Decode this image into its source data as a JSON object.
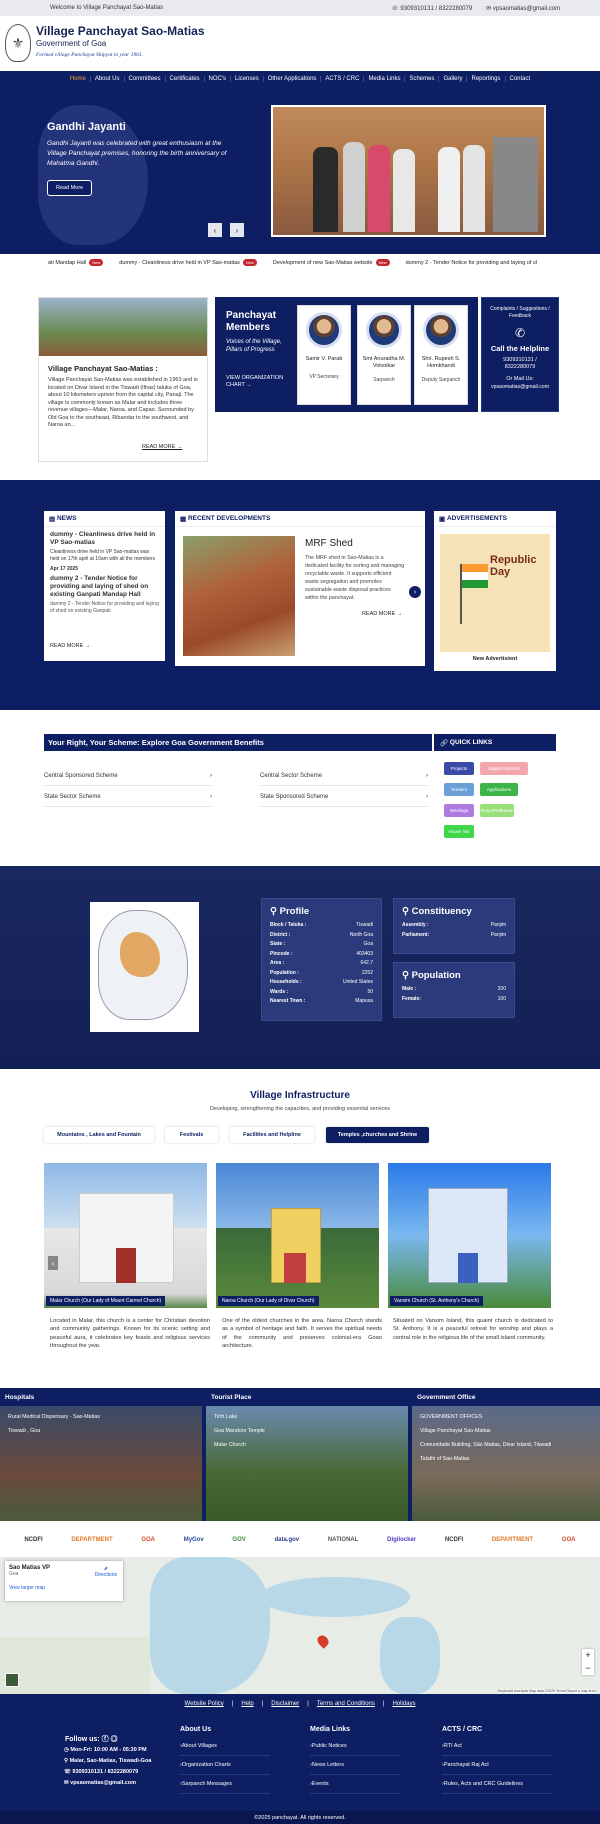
{
  "topbar": {
    "welcome": "Welcome to Village Panchayat Sao-Matias",
    "phone": "9309310131 / 8322280079",
    "email": "vpsaomatias@gmail.com"
  },
  "header": {
    "title": "Village Panchayat Sao-Matias",
    "subtitle": "Government of Goa",
    "tagline": "Formed village Panchayat Shipyat in year 1961."
  },
  "nav": [
    "Home",
    "About Us",
    "Committees",
    "Certificates",
    "NOC's",
    "Licenses",
    "Other Applications",
    "ACTS / CRC",
    "Media Links",
    "Schemes",
    "Gallery",
    "Reportings",
    "Contact"
  ],
  "hero": {
    "title": "Gandhi Jayanti",
    "text": "Gandhi Jayanti was celebrated with great enthusiasm at the Village Panchayat premises, honoring the birth anniversary of Mahatma Gandhi.",
    "button": "Read More",
    "prev": "‹",
    "next": "›"
  },
  "ticker": [
    "ati Mandap Hall",
    "dummy - Cleanliness drive held in VP Sao-matias",
    "Development of new Sao-Matias website",
    "dummy 2 - Tender Notice for providing and laying of sl"
  ],
  "ticker_tag": "New",
  "about": {
    "heading": "Village Panchayat Sao-Matias :",
    "text": "Village Panchayat Sao-Matias was established in 1963 and is located on Divar Island in the Tiswadi (Ilhas) taluka of Goa, about 10 kilometers upriver from the capital city, Panaji. The village is commonly known as Malar and includes three revenue villages—Malar, Naroa, and Capao. Surrounded by Old Goa to the southeast, Ribandar to the southwest, and Naroa an...",
    "more": "READ MORE →"
  },
  "members": {
    "heading": "Panchayat Members",
    "sub": "Voices of the Village, Pillars of Progress",
    "chart": "VIEW ORGANIZATION CHART →",
    "people": [
      {
        "name": "Samir V. Parab",
        "role": "VP Secretary"
      },
      {
        "name": "Smt Anuradha M. Volvoikar",
        "role": "Sarpanch"
      },
      {
        "name": "Shri. Rupesh S. Homkhandi",
        "role": "Deputy Sarpanch"
      }
    ]
  },
  "helpline": {
    "top": "Complaints / Suggestions / Feedback",
    "title": "Call the Helpline",
    "phone": "9309310131 / 8322280079",
    "or": "Or Mail Us:",
    "email": "vpsaomatias@gmail.com"
  },
  "news": {
    "heading": "NEWS",
    "items": [
      {
        "title": "dummy - Cleanliness drive held in VP Sao-matias",
        "text": "Cleanliness drive held in VP Sao-matias was held on 17th april at 10am with all the members"
      },
      {
        "date": "Apr 17 2025",
        "title": "dummy 2 - Tender Notice for providing and laying of shed on existing Ganpati Mandap Hall",
        "text": "dummy 2 - Tender Notice for providing and laying of shed on existing Ganpati"
      }
    ],
    "more": "READ MORE →"
  },
  "developments": {
    "heading": "RECENT DEVELOPMENTS",
    "title": "MRF Shed",
    "text": "The MRF shed in Sao-Matias is a dedicated facility for sorting and managing recyclable waste. It supports efficient waste segregation and promotes sustainable waste disposal practices within the panchayat.",
    "more": "READ MORE →"
  },
  "ads": {
    "heading": "ADVERTISEMENTS",
    "banner": "Republic Day",
    "caption": "New Advertisient"
  },
  "schemes": {
    "heading": "Your Right, Your Scheme: Explore Goa Government Benefits",
    "items": [
      "Central Sponsored Scheme",
      "Central Sector Scheme",
      "State Sector Scheme",
      "State Sponsored Scheme"
    ]
  },
  "quick_links": {
    "heading": "QUICK LINKS",
    "items": [
      {
        "label": "Projects",
        "color": "#3b4aa8"
      },
      {
        "label": "Digital Payment",
        "color": "#f3a7ad"
      },
      {
        "label": "Tenders",
        "color": "#6b9fd8"
      },
      {
        "label": "Applications",
        "color": "#3bb54a"
      },
      {
        "label": "Meetings",
        "color": "#b07be0"
      },
      {
        "label": "Goa ePrathasan",
        "color": "#9ae07a"
      },
      {
        "label": "House Tax",
        "color": "#3ed84a"
      }
    ]
  },
  "profile": {
    "heading": "Profile",
    "rows": [
      [
        "Block / Taluka :",
        "Tiswadi"
      ],
      [
        "District :",
        "North Goa"
      ],
      [
        "State :",
        "Goa"
      ],
      [
        "Pincode :",
        "403403"
      ],
      [
        "Area :",
        "642.7"
      ],
      [
        "Population :",
        "2252"
      ],
      [
        "Households :",
        "United States"
      ],
      [
        "Wards :",
        "50"
      ],
      [
        "Nearest Town :",
        "Mapusa"
      ]
    ]
  },
  "constituency": {
    "heading": "Constituency",
    "rows": [
      [
        "Assembly :",
        "Panjim"
      ],
      [
        "Parliament:",
        "Panjim"
      ]
    ]
  },
  "population": {
    "heading": "Population",
    "rows": [
      [
        "Male :",
        "200"
      ],
      [
        "Female:",
        "100"
      ]
    ]
  },
  "infra": {
    "heading": "Village Infrastructure",
    "sub": "Developing, strengthening the capacities, and providing essential services",
    "tabs": [
      "Mountains , Lakes and Fountain",
      "Festivals",
      "Facilities and Helpline",
      "Temples ,churches and Shrine"
    ],
    "churches": [
      {
        "caption": "Malar Church (Our Lady of Mount Carmel Church)",
        "text": "Located in Malar, this church is a center for Christian devotion and community gatherings. Known for its scenic setting and peaceful aura, it celebrates key feasts and religious services throughout the year."
      },
      {
        "caption": "Naroa Church (Our Lady of Divar Church)",
        "text": "One of the oldest churches in the area, Naroa Church stands as a symbol of heritage and faith. It serves the spiritual needs of the community and preserves colonial-era Goan architecture."
      },
      {
        "caption": "Vanxim Church (St. Anthony's Church)",
        "text": "Situated on Vanxim Island, this quaint church is dedicated to St. Anthony. It is a peaceful retreat for worship and plays a central role in the religious life of the small island community."
      }
    ]
  },
  "places": [
    {
      "heading": "Hospitals",
      "items": [
        "Rural Medical Dispensary - Sao-Matias",
        "Tiswadi , Goa"
      ]
    },
    {
      "heading": "Tourist Place",
      "items": [
        "Tirth Lake",
        "Goa Mandore Temple",
        "Malar Church"
      ]
    },
    {
      "heading": "Government Office",
      "items": [
        "GOVERNMENT OFFICES",
        "Village Panchayat Sao-Matias",
        "Comunidade Building, São Matias, Divar Island, Tiswadi",
        "Talathi of Sao-Matias"
      ]
    }
  ],
  "logos": [
    "NCDFI",
    "DEPARTMENT",
    "GOA",
    "MyGov",
    "GOV",
    "data.gov",
    "NATIONAL",
    "Digilocker",
    "NCDFI",
    "DEPARTMENT",
    "GOA"
  ],
  "map": {
    "place": "Sao Matias VP",
    "region": "Goa",
    "larger": "View larger map",
    "directions": "Directions",
    "footer": "Keyboard shortcuts   Map data ©2025   Terms   Report a map error"
  },
  "footlinks": [
    "Website Policy",
    "Help",
    "Disclaimer",
    "Terms and Conditions",
    "Holidays"
  ],
  "footer": {
    "follow": "Follow us:",
    "hours": "Mon-Fri: 10:00 AM - 05:30 PM",
    "address": "Malar, Sao-Matias, Tiswadi-Goa",
    "phone": "9309310131 / 8322280079",
    "email": "vpsaomatias@gmail.com",
    "cols": [
      {
        "heading": "About Us",
        "items": [
          "About Villages",
          "Organization Charts",
          "Sarpanch Messages"
        ]
      },
      {
        "heading": "Media Links",
        "items": [
          "Public Notices",
          "News Letters",
          "Events"
        ]
      },
      {
        "heading": "ACTS / CRC",
        "items": [
          "RTI Act",
          "Panchayat Raj Act",
          "Rules, Acts and CRC Guidelines"
        ]
      }
    ],
    "copyright": "©2025 panchayat. All rights reserved."
  }
}
